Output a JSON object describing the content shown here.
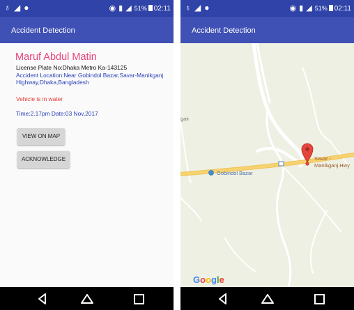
{
  "app_title": "Accident Detection",
  "status_bar": {
    "battery": "51%",
    "time": "02:11"
  },
  "details": {
    "name": "Maruf Abdul Matin",
    "license_plate": "License Plate No:Dhaka Metro Ka-143125",
    "location": "Accident Location:Near Gobindol Bazar,Savar-Manikganj Highway,Dhaka,Bangladesh",
    "status": "Vehicle is in water",
    "datetime": "Time:2.17pm  Date:03 Nov,2017"
  },
  "buttons": {
    "view_on_map": "VIEW ON MAP",
    "acknowledge": "ACKNOWLEDGE"
  },
  "map": {
    "place_label": "Gobindol Bazar",
    "marker_label_line1": "Savar -",
    "marker_label_line2": "Manikganj Hwy",
    "edge_label": "gair",
    "logo": [
      "G",
      "o",
      "o",
      "g",
      "l",
      "e"
    ]
  },
  "colors": {
    "status_bar": "#2f43a8",
    "app_bar": "#3f51b5",
    "name_text": "#e8457a",
    "link_text": "#283fb6",
    "alert_text": "#e53935",
    "marker": "#e5453c",
    "highway": "#f6d36f",
    "map_background": "#eef0e3"
  },
  "icons": [
    "wifi-icon",
    "sim-icon",
    "signal-icon",
    "battery-icon",
    "back-icon",
    "home-icon",
    "recents-icon",
    "map-pin-icon",
    "bus-stop-icon"
  ]
}
